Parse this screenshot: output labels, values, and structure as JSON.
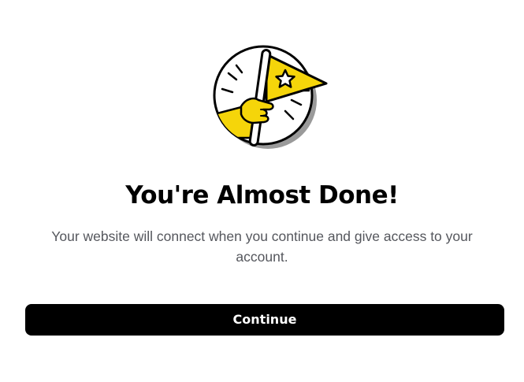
{
  "dialog": {
    "title": "You're Almost Done!",
    "description": "Your website will connect when you continue and give access to your account.",
    "continue_label": "Continue",
    "illustration_icon": "pennant-flag-icon"
  },
  "colors": {
    "accent_yellow": "#f5d50a",
    "button_bg": "#000000",
    "button_text": "#ffffff",
    "description_text": "#55575d"
  }
}
